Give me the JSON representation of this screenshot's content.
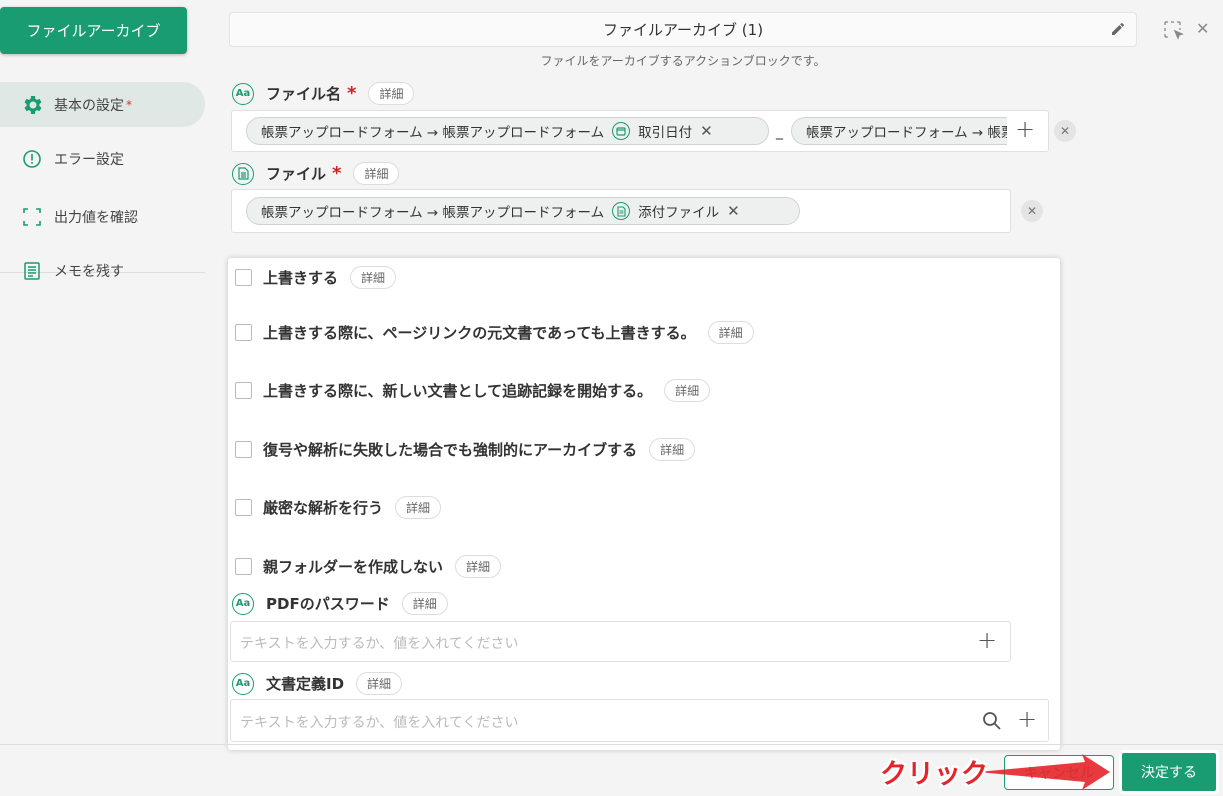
{
  "sidebar": {
    "badge": "ファイルアーカイブ",
    "items": [
      {
        "label": "基本の設定",
        "star": "*"
      },
      {
        "label": "エラー設定"
      },
      {
        "label": "出力値を確認"
      },
      {
        "label": "メモを残す"
      }
    ]
  },
  "header": {
    "title": "ファイルアーカイブ (1)",
    "subtitle": "ファイルをアーカイブするアクションブロックです。"
  },
  "fields": {
    "filename": {
      "label": "ファイル名",
      "required": "*",
      "detail": "詳細",
      "chip1_text": "帳票アップロードフォーム → 帳票アップロードフォーム",
      "chip1_tail": "取引日付",
      "separator": "_",
      "chip2_text": "帳票アップロードフォーム → 帳票アップロードフォーム"
    },
    "file": {
      "label": "ファイル",
      "required": "*",
      "detail": "詳細",
      "chip_text": "帳票アップロードフォーム → 帳票アップロードフォーム",
      "chip_tail": "添付ファイル"
    }
  },
  "panel": {
    "checkboxes": [
      {
        "label": "上書きする",
        "detail": "詳細"
      },
      {
        "label": "上書きする際に、ページリンクの元文書であっても上書きする。",
        "detail": "詳細"
      },
      {
        "label": "上書きする際に、新しい文書として追跡記録を開始する。",
        "detail": "詳細"
      },
      {
        "label": "復号や解析に失敗した場合でも強制的にアーカイブする",
        "detail": "詳細"
      },
      {
        "label": "厳密な解析を行う",
        "detail": "詳細"
      },
      {
        "label": "親フォルダーを作成しない",
        "detail": "詳細"
      }
    ],
    "pdf_password": {
      "label": "PDFのパスワード",
      "detail": "詳細",
      "placeholder": "テキストを入力するか、値を入れてください"
    },
    "doc_def_id": {
      "label": "文書定義ID",
      "detail": "詳細",
      "placeholder": "テキストを入力するか、値を入れてください"
    }
  },
  "footer": {
    "cancel": "キャンセル",
    "ok": "決定する",
    "annotation": "クリック"
  },
  "colors": {
    "accent": "#1a9c73",
    "annotation": "#e5242a"
  }
}
